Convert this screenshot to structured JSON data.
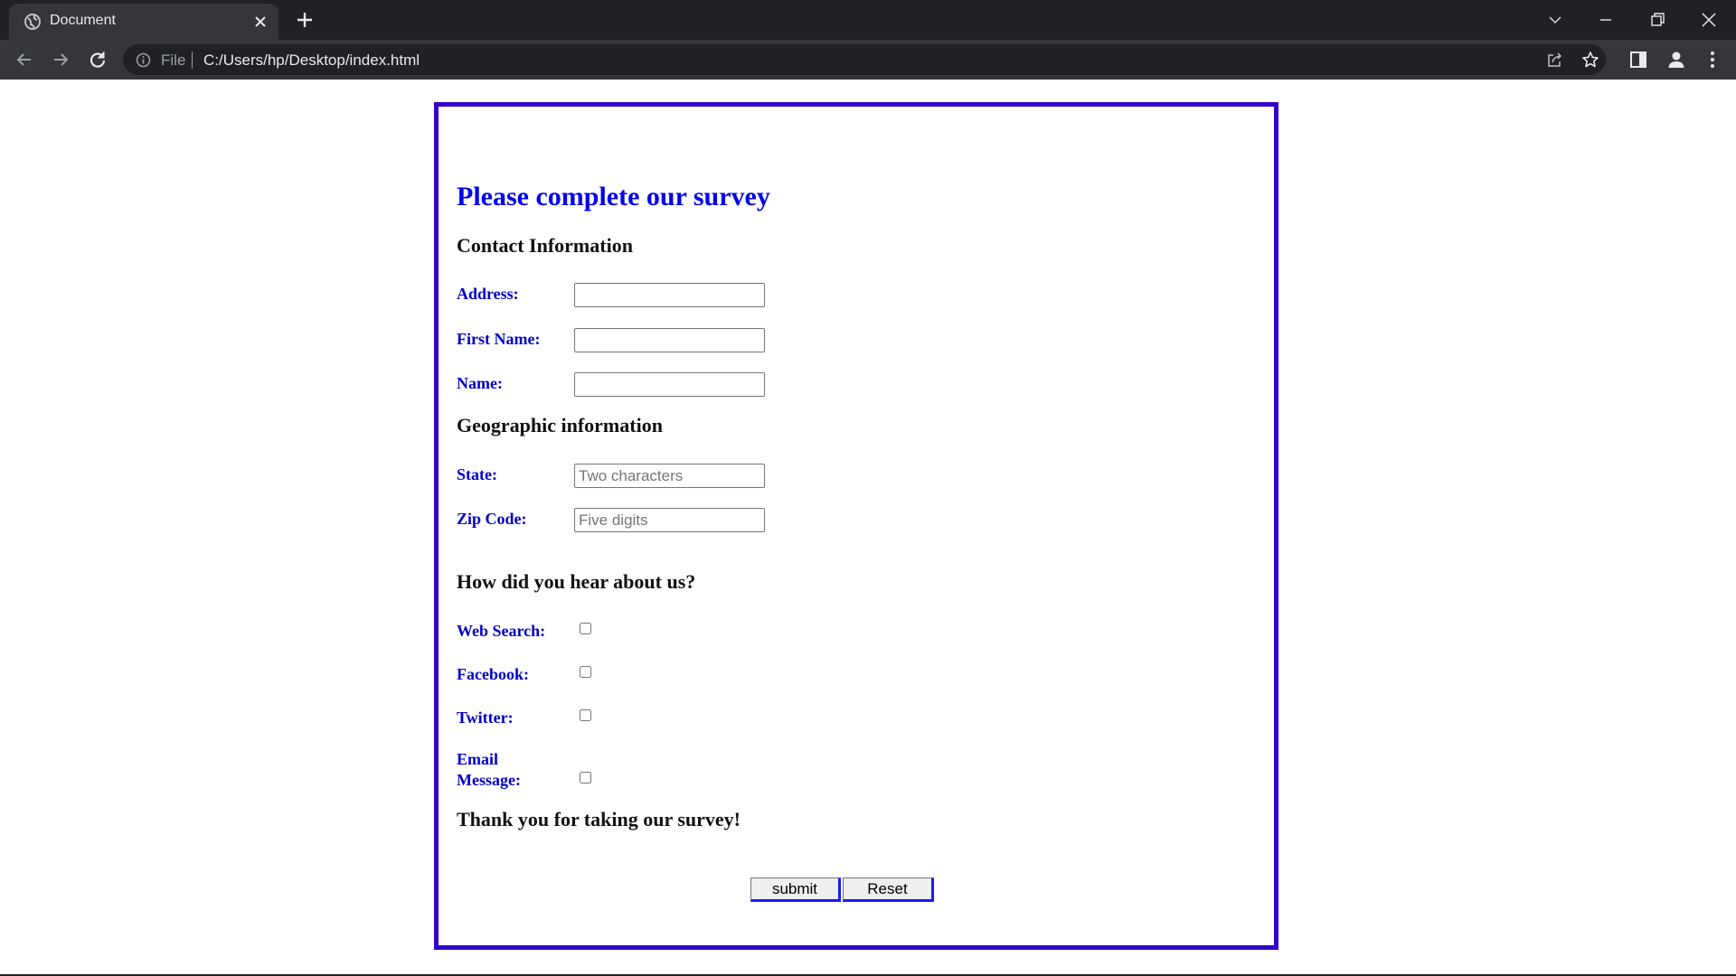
{
  "browser": {
    "tab_title": "Document",
    "address_scheme": "File",
    "address_url": "C:/Users/hp/Desktop/index.html"
  },
  "survey": {
    "title": "Please complete our survey",
    "contact": {
      "heading": "Contact Information",
      "address_label": "Address:",
      "address_value": "",
      "first_name_label": "First Name:",
      "first_name_value": "",
      "name_label": "Name:",
      "name_value": ""
    },
    "geo": {
      "heading": "Geographic information",
      "state_label": "State:",
      "state_placeholder": "Two characters",
      "zip_label": "Zip Code:",
      "zip_placeholder": "Five digits"
    },
    "hear": {
      "heading": "How did you hear about us?",
      "options": [
        {
          "label": "Web Search:",
          "checked": false
        },
        {
          "label": "Facebook:",
          "checked": false
        },
        {
          "label": "Twitter:",
          "checked": false
        },
        {
          "label_line1": "Email",
          "label_line2": "Message:",
          "checked": false
        }
      ]
    },
    "thanks": "Thank you for taking our survey!",
    "submit_label": "submit",
    "reset_label": "Reset"
  },
  "colors": {
    "border": "#3300cc",
    "title": "#0000ee",
    "label": "#0000cc",
    "button_accent": "#1a1aff"
  }
}
